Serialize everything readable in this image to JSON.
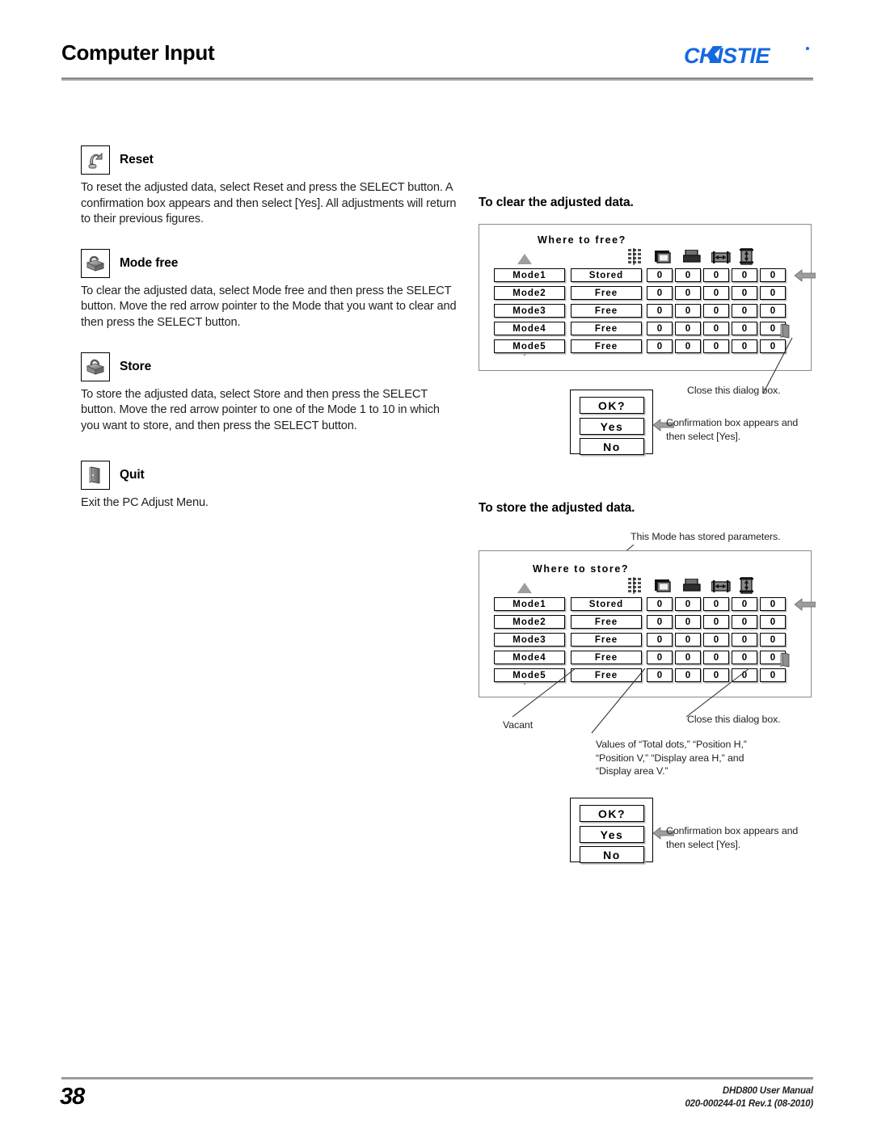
{
  "header": {
    "title": "Computer Input",
    "brand": "CHRISTIE",
    "brand_color": "#1569e0"
  },
  "footer": {
    "page_number": "38",
    "manual": "DHD800 User Manual",
    "doc_id": "020-000244-01 Rev.1 (08-2010)"
  },
  "left_column": {
    "items": [
      {
        "icon": "reset-icon",
        "title": "Reset",
        "body": "To reset the adjusted data, select Reset and press the SELECT button. A confirmation box appears and then select [Yes]. All adjustments will return to their previous figures."
      },
      {
        "icon": "mode-free-icon",
        "title": "Mode free",
        "body": "To clear the adjusted data, select Mode free and then press the SELECT button. Move the red arrow pointer to the Mode that you want to clear and then press the SELECT button."
      },
      {
        "icon": "store-icon",
        "title": "Store",
        "body": "To store the adjusted data, select Store and then press the SELECT button. Move the red arrow pointer to one of the Mode 1 to 10 in which you want to store, and then press the SELECT button."
      },
      {
        "icon": "quit-door-icon",
        "title": "Quit",
        "body": "Exit the PC Adjust Menu."
      }
    ]
  },
  "right_column": {
    "clear_section": {
      "title": "To clear the adjusted data.",
      "osd": {
        "caption": "Where to free?",
        "scroll_up": "triangle-up-icon",
        "scroll_down": "triangle-down-icon",
        "column_icons": [
          "total-dots-icon",
          "position-h-icon",
          "position-v-icon",
          "display-area-h-icon",
          "display-area-v-icon"
        ],
        "rows": [
          {
            "mode": "Mode1",
            "status": "Stored",
            "values": [
              "0",
              "0",
              "0",
              "0",
              "0"
            ]
          },
          {
            "mode": "Mode2",
            "status": "Free",
            "values": [
              "0",
              "0",
              "0",
              "0",
              "0"
            ]
          },
          {
            "mode": "Mode3",
            "status": "Free",
            "values": [
              "0",
              "0",
              "0",
              "0",
              "0"
            ]
          },
          {
            "mode": "Mode4",
            "status": "Free",
            "values": [
              "0",
              "0",
              "0",
              "0",
              "0"
            ]
          },
          {
            "mode": "Mode5",
            "status": "Free",
            "values": [
              "0",
              "0",
              "0",
              "0",
              "0"
            ]
          }
        ],
        "pointer": "red-arrow-pointer",
        "quit": "quit-door-icon"
      },
      "callouts": {
        "close_dialog": "Close this dialog box.",
        "confirmation": "Confirmation box appears and then select [Yes]."
      },
      "confirm_box": {
        "title": "OK?",
        "yes": "Yes",
        "no": "No",
        "pointer": "red-arrow-pointer"
      }
    },
    "store_section": {
      "title": "To store the adjusted data.",
      "stored_note": "This Mode has stored parameters.",
      "osd": {
        "caption": "Where to store?",
        "scroll_up": "triangle-up-icon",
        "scroll_down": "triangle-down-icon",
        "column_icons": [
          "total-dots-icon",
          "position-h-icon",
          "position-v-icon",
          "display-area-h-icon",
          "display-area-v-icon"
        ],
        "rows": [
          {
            "mode": "Mode1",
            "status": "Stored",
            "values": [
              "0",
              "0",
              "0",
              "0",
              "0"
            ]
          },
          {
            "mode": "Mode2",
            "status": "Free",
            "values": [
              "0",
              "0",
              "0",
              "0",
              "0"
            ]
          },
          {
            "mode": "Mode3",
            "status": "Free",
            "values": [
              "0",
              "0",
              "0",
              "0",
              "0"
            ]
          },
          {
            "mode": "Mode4",
            "status": "Free",
            "values": [
              "0",
              "0",
              "0",
              "0",
              "0"
            ]
          },
          {
            "mode": "Mode5",
            "status": "Free",
            "values": [
              "0",
              "0",
              "0",
              "0",
              "0"
            ]
          }
        ],
        "pointer": "red-arrow-pointer",
        "quit": "quit-door-icon"
      },
      "callouts": {
        "vacant": "Vacant",
        "values": "Values of “Total dots,” “Position H,” “Position V,” “Display area H,” and “Display area V.”",
        "close_dialog": "Close this dialog box.",
        "confirmation": "Confirmation box appears and then select [Yes]."
      },
      "confirm_box": {
        "title": "OK?",
        "yes": "Yes",
        "no": "No",
        "pointer": "red-arrow-pointer"
      }
    }
  }
}
